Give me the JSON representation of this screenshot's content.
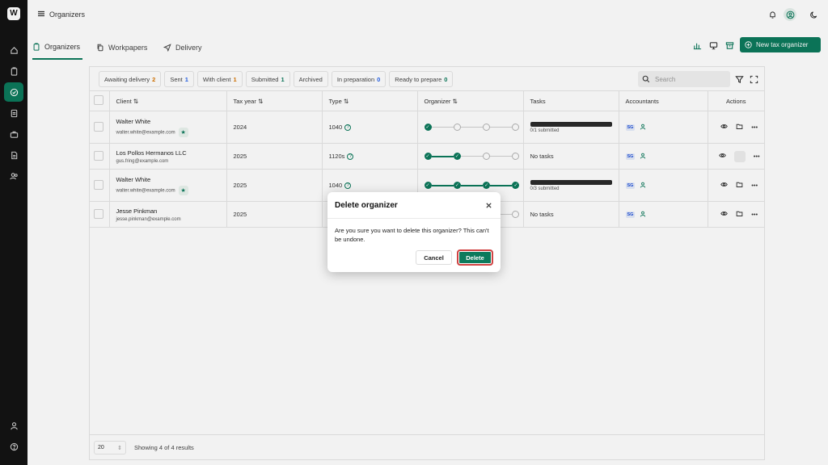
{
  "app": {
    "logo_text": "W"
  },
  "header": {
    "title": "Organizers"
  },
  "tabs": [
    {
      "label": "Organizers",
      "icon": "clipboard-icon"
    },
    {
      "label": "Workpapers",
      "icon": "copy-icon"
    },
    {
      "label": "Delivery",
      "icon": "send-icon"
    }
  ],
  "actions": {
    "new_label": "New tax organizer"
  },
  "filters": [
    {
      "label": "Awaiting delivery",
      "count": "2",
      "color": "#d97706"
    },
    {
      "label": "Sent",
      "count": "1",
      "color": "#2563eb"
    },
    {
      "label": "With client",
      "count": "1",
      "color": "#d97706"
    },
    {
      "label": "Submitted",
      "count": "1",
      "color": "#0c7a5c"
    },
    {
      "label": "Archived",
      "count": "",
      "color": "#444444"
    },
    {
      "label": "In preparation",
      "count": "0",
      "color": "#2563eb"
    },
    {
      "label": "Ready to prepare",
      "count": "0",
      "color": "#0c7a5c"
    }
  ],
  "search": {
    "placeholder": "Search"
  },
  "table": {
    "columns": {
      "client": "Client",
      "tax_year": "Tax year",
      "type": "Type",
      "organizer": "Organizer",
      "tasks": "Tasks",
      "accountants": "Accountants",
      "actions": "Actions"
    },
    "rows": [
      {
        "name": "Walter White",
        "email": "walter.white@example.com",
        "year": "2024",
        "type": "1040",
        "steps": 1,
        "tasks_label": "0/1 submitted",
        "has_task_bar": true,
        "accountant": "SG",
        "starred": true
      },
      {
        "name": "Los Pollos Hermanos LLC",
        "email": "gus.fring@example.com",
        "year": "2025",
        "type": "1120s",
        "steps": 2,
        "tasks_label": "No tasks",
        "has_task_bar": false,
        "accountant": "SG",
        "starred": false
      },
      {
        "name": "Walter White",
        "email": "walter.white@example.com",
        "year": "2025",
        "type": "1040",
        "steps": 4,
        "tasks_label": "0/3 submitted",
        "has_task_bar": true,
        "accountant": "SG",
        "starred": true
      },
      {
        "name": "Jesse Pinkman",
        "email": "jesse.pinkman@example.com",
        "year": "2025",
        "type": "",
        "steps": 0,
        "tasks_label": "No tasks",
        "has_task_bar": false,
        "accountant": "SG",
        "starred": false
      }
    ]
  },
  "footer": {
    "page_size": "20",
    "showing": "Showing 4 of 4 results"
  },
  "modal": {
    "title": "Delete organizer",
    "body": "Are you sure you want to delete this organizer? This can't be undone.",
    "cancel_label": "Cancel",
    "delete_label": "Delete"
  }
}
